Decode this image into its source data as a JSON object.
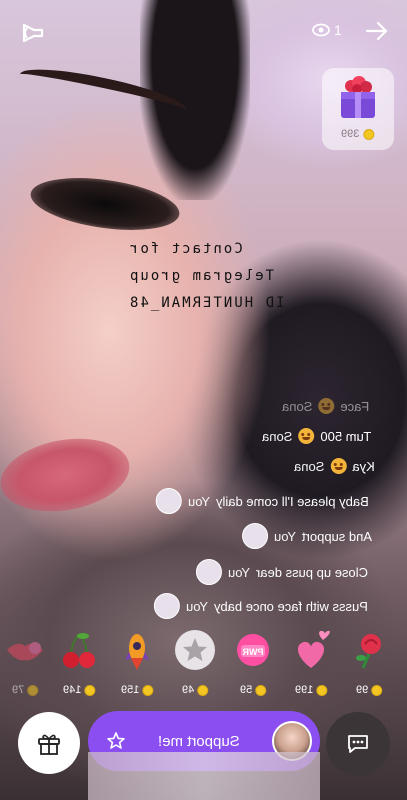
{
  "header": {
    "viewer_count": "1",
    "icons": {
      "sound": "speaker-icon",
      "viewers": "eye-icon",
      "exit": "arrow-right-icon"
    }
  },
  "featured_gift": {
    "price": "399",
    "icon": "gift-box-icon"
  },
  "watermark": {
    "line1": "Contact for",
    "line2": "Telegram group",
    "line3": "ID HUNTERMAN_48"
  },
  "chat": [
    {
      "name": "Sona",
      "emoji": "grinning-emoji",
      "text": "Face"
    },
    {
      "name": "Sona",
      "emoji": "grinning-emoji",
      "text": "Tum 500"
    },
    {
      "name": "Sona",
      "emoji": "grinning-emoji",
      "text": "Kya"
    },
    {
      "name": "You",
      "text": "Baby please I'll come daily"
    },
    {
      "name": "You",
      "text": "And support"
    },
    {
      "name": "You",
      "text": "Close up puss dear"
    },
    {
      "name": "You",
      "text": "Pusss with face once baby"
    }
  ],
  "gift_strip": [
    {
      "icon": "rose-icon",
      "price": "99"
    },
    {
      "icon": "hearts-icon",
      "price": "199"
    },
    {
      "icon": "pwr-badge-icon",
      "price": "59"
    },
    {
      "icon": "star-icon",
      "price": "49"
    },
    {
      "icon": "rocket-icon",
      "price": "159"
    },
    {
      "icon": "cherry-icon",
      "price": "149"
    },
    {
      "icon": "lips-icon",
      "price": "79"
    }
  ],
  "bottom_bar": {
    "support_label": "Support me!",
    "icons": {
      "gift": "gift-icon",
      "star": "star-icon",
      "chat": "chat-bubble-icon"
    }
  },
  "colors": {
    "accent": "#8b4ef0",
    "coin": "#f3c623"
  }
}
